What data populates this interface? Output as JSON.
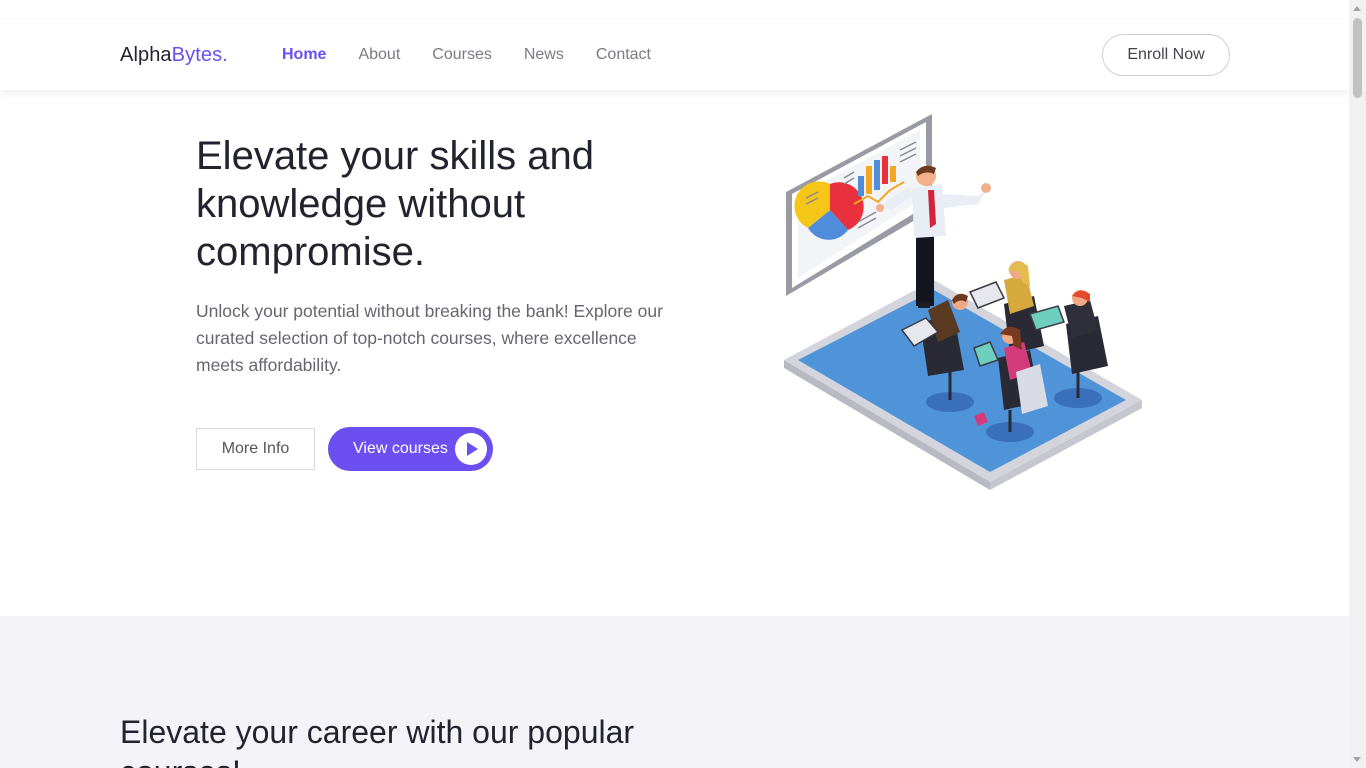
{
  "brand": {
    "part1": "Alpha",
    "part2": "Bytes.",
    "accent_color": "#6c4ff0"
  },
  "nav": {
    "items": [
      {
        "label": "Home",
        "active": true
      },
      {
        "label": "About",
        "active": false
      },
      {
        "label": "Courses",
        "active": false
      },
      {
        "label": "News",
        "active": false
      },
      {
        "label": "Contact",
        "active": false
      }
    ],
    "enroll_label": "Enroll Now"
  },
  "hero": {
    "title": "Elevate your skills and knowledge without compromise.",
    "description": "Unlock your potential without breaking the bank! Explore our curated selection of top-notch courses, where excellence meets affordability.",
    "more_info_label": "More Info",
    "view_courses_label": "View courses",
    "play_icon": "play-icon",
    "illustration": "presentation-classroom-illustration"
  },
  "courses_section": {
    "title": "Elevate your career with our popular courses!"
  },
  "colors": {
    "primary": "#6c4ff0",
    "text_dark": "#23232f",
    "text_muted": "#666672",
    "section_bg": "#f4f4f8"
  }
}
